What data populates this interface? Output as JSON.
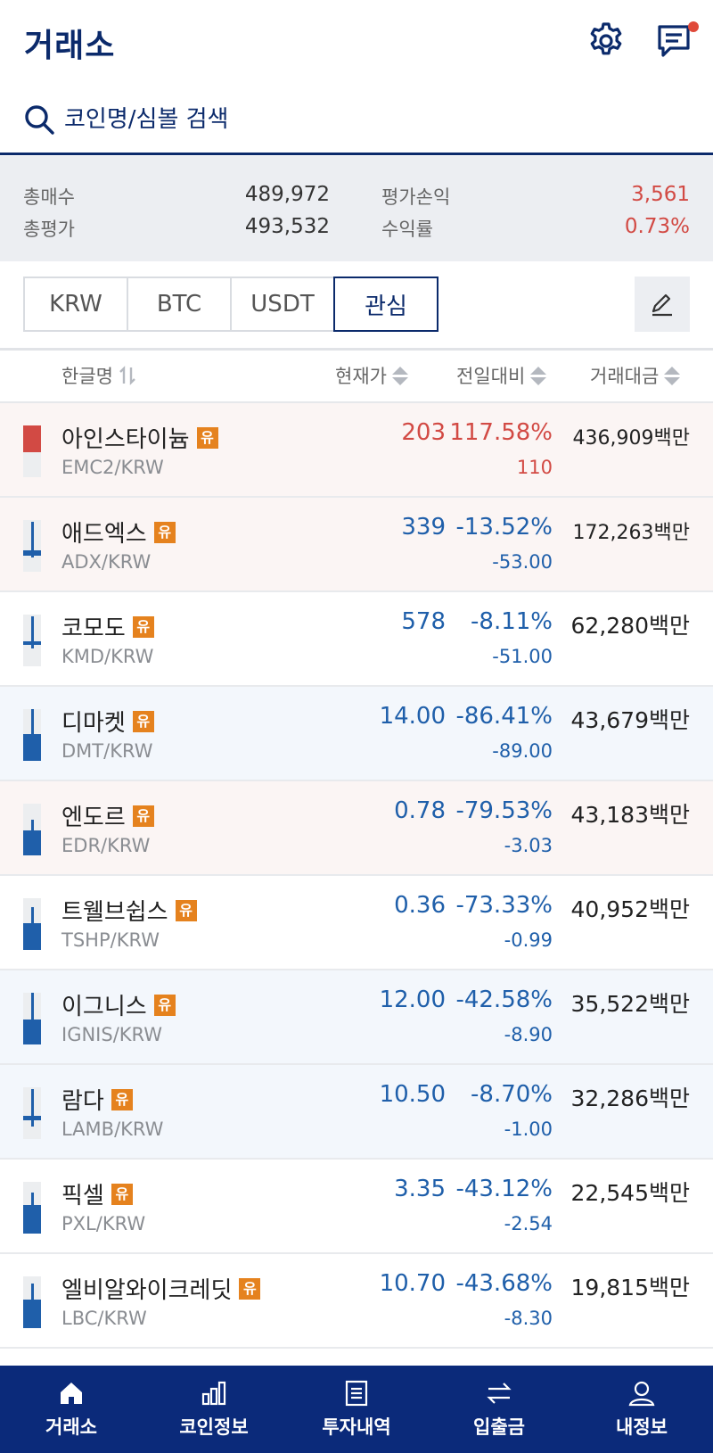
{
  "header": {
    "title": "거래소",
    "settings_icon": "gear-icon",
    "message_icon": "chat-icon"
  },
  "search": {
    "placeholder": "코인명/심볼 검색"
  },
  "summary": {
    "total_buy_label": "총매수",
    "total_buy_value": "489,972",
    "total_eval_label": "총평가",
    "total_eval_value": "493,532",
    "pnl_label": "평가손익",
    "pnl_value": "3,561",
    "rate_label": "수익률",
    "rate_value": "0.73%"
  },
  "tabs": [
    {
      "label": "KRW"
    },
    {
      "label": "BTC"
    },
    {
      "label": "USDT"
    },
    {
      "label": "관심"
    }
  ],
  "columns": {
    "name": "한글명",
    "price": "현재가",
    "change": "전일대비",
    "volume": "거래대금"
  },
  "colors": {
    "up": "#d24a44",
    "down": "#1f5faa",
    "brand": "#0b2a7a",
    "badge": "#e5821e"
  },
  "coins": [
    {
      "name": "아인스타이늄",
      "badge": "유",
      "symbol": "EMC2/KRW",
      "price": "203",
      "pct": "117.58%",
      "chg": "110",
      "volume": "436,909백만",
      "dir": "up"
    },
    {
      "name": "애드엑스",
      "badge": "유",
      "symbol": "ADX/KRW",
      "price": "339",
      "pct": "-13.52%",
      "chg": "-53.00",
      "volume": "172,263백만",
      "dir": "down"
    },
    {
      "name": "코모도",
      "badge": "유",
      "symbol": "KMD/KRW",
      "price": "578",
      "pct": "-8.11%",
      "chg": "-51.00",
      "volume": "62,280백만",
      "dir": "down"
    },
    {
      "name": "디마켓",
      "badge": "유",
      "symbol": "DMT/KRW",
      "price": "14.00",
      "pct": "-86.41%",
      "chg": "-89.00",
      "volume": "43,679백만",
      "dir": "down"
    },
    {
      "name": "엔도르",
      "badge": "유",
      "symbol": "EDR/KRW",
      "price": "0.78",
      "pct": "-79.53%",
      "chg": "-3.03",
      "volume": "43,183백만",
      "dir": "down"
    },
    {
      "name": "트웰브쉽스",
      "badge": "유",
      "symbol": "TSHP/KRW",
      "price": "0.36",
      "pct": "-73.33%",
      "chg": "-0.99",
      "volume": "40,952백만",
      "dir": "down"
    },
    {
      "name": "이그니스",
      "badge": "유",
      "symbol": "IGNIS/KRW",
      "price": "12.00",
      "pct": "-42.58%",
      "chg": "-8.90",
      "volume": "35,522백만",
      "dir": "down"
    },
    {
      "name": "람다",
      "badge": "유",
      "symbol": "LAMB/KRW",
      "price": "10.50",
      "pct": "-8.70%",
      "chg": "-1.00",
      "volume": "32,286백만",
      "dir": "down"
    },
    {
      "name": "픽셀",
      "badge": "유",
      "symbol": "PXL/KRW",
      "price": "3.35",
      "pct": "-43.12%",
      "chg": "-2.54",
      "volume": "22,545백만",
      "dir": "down"
    },
    {
      "name": "엘비알와이크레딧",
      "badge": "유",
      "symbol": "LBC/KRW",
      "price": "10.70",
      "pct": "-43.68%",
      "chg": "-8.30",
      "volume": "19,815백만",
      "dir": "down"
    }
  ],
  "nav": [
    {
      "label": "거래소",
      "icon": "home-icon"
    },
    {
      "label": "코인정보",
      "icon": "bar-chart-icon"
    },
    {
      "label": "투자내역",
      "icon": "document-icon"
    },
    {
      "label": "입출금",
      "icon": "transfer-icon"
    },
    {
      "label": "내정보",
      "icon": "user-icon"
    }
  ]
}
